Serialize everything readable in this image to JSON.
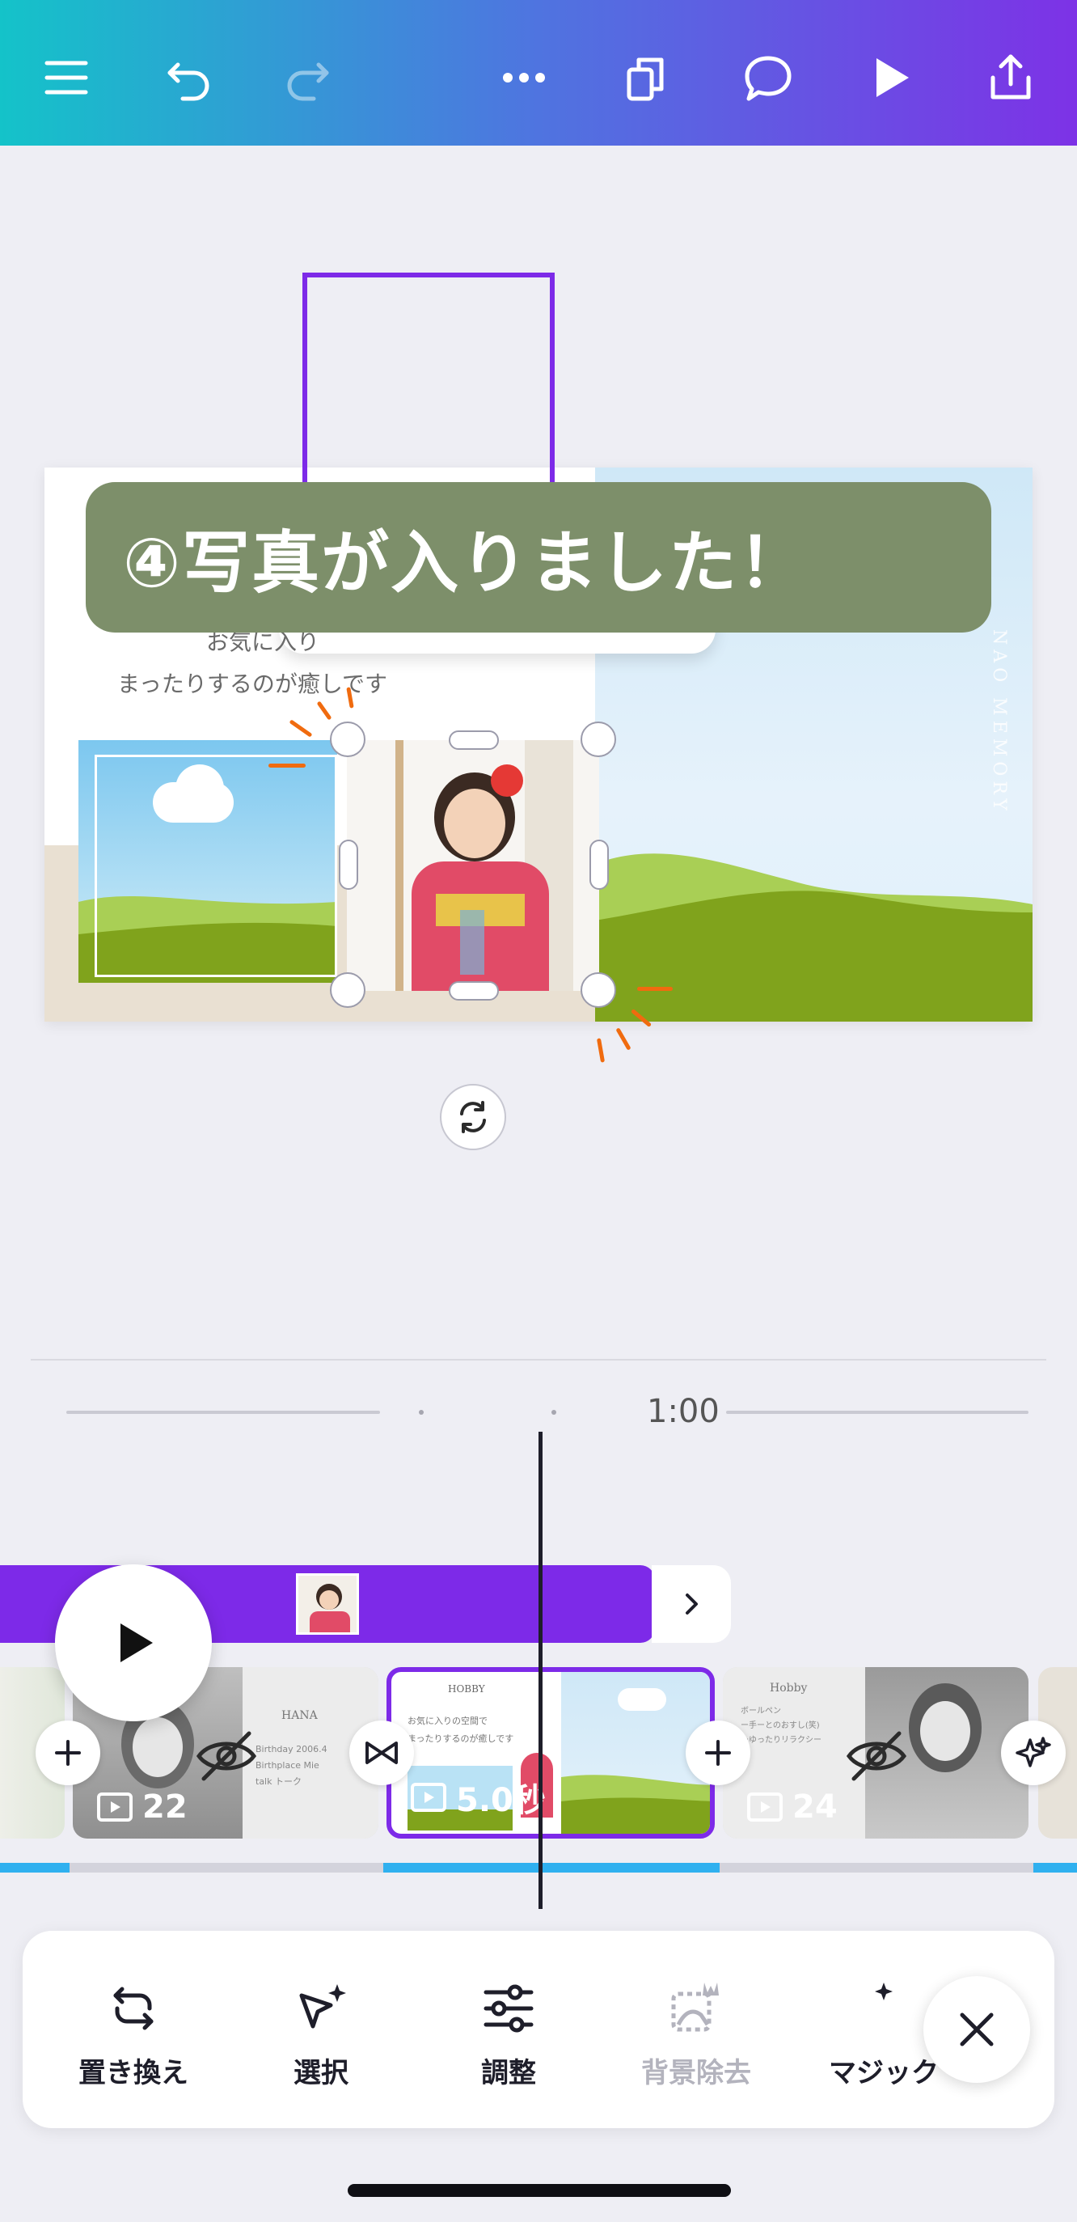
{
  "top_toolbar": {
    "icons": [
      "menu-icon",
      "undo-icon",
      "redo-icon",
      "more-icon",
      "pages-icon",
      "comment-icon",
      "play-icon",
      "share-icon"
    ]
  },
  "canvas": {
    "body_text_line1": "お気に入り",
    "body_text_line2": "まったりするのが癒しです",
    "vertical_text": "NAO MEMORY"
  },
  "banner": {
    "text": "④写真が入りました！",
    "color": "#7d8f6a"
  },
  "timeline": {
    "time_label": "1:00",
    "clips": [
      {
        "label": "22",
        "hidden": true
      },
      {
        "label": "5.0秒",
        "hidden": false,
        "selected": true
      },
      {
        "label": "24",
        "hidden": true
      }
    ],
    "clip_text": {
      "clip22_title": "HANA",
      "clip22_lines": [
        "Birthday  2006.4",
        "Birthplace  Mie",
        "talk  トーク"
      ],
      "clip23_title": "HOBBY",
      "clip23_lines": [
        "お気に入りの空間で",
        "まったりするのが癒しです"
      ],
      "clip24_title": "Hobby",
      "clip24_lines": [
        "ボールペン",
        "ー手ーとのおすし(笑)",
        "ーゆったりリラクシー"
      ]
    }
  },
  "actions": {
    "replace": "置き換え",
    "select": "選択",
    "adjust": "調整",
    "bg_remove": "背景除去",
    "magic": "マジック"
  },
  "colors": {
    "accent": "#7d2ae8",
    "progress": "#2fb0ef",
    "gradient_start": "#14c3c9",
    "gradient_end": "#7d32e6"
  }
}
